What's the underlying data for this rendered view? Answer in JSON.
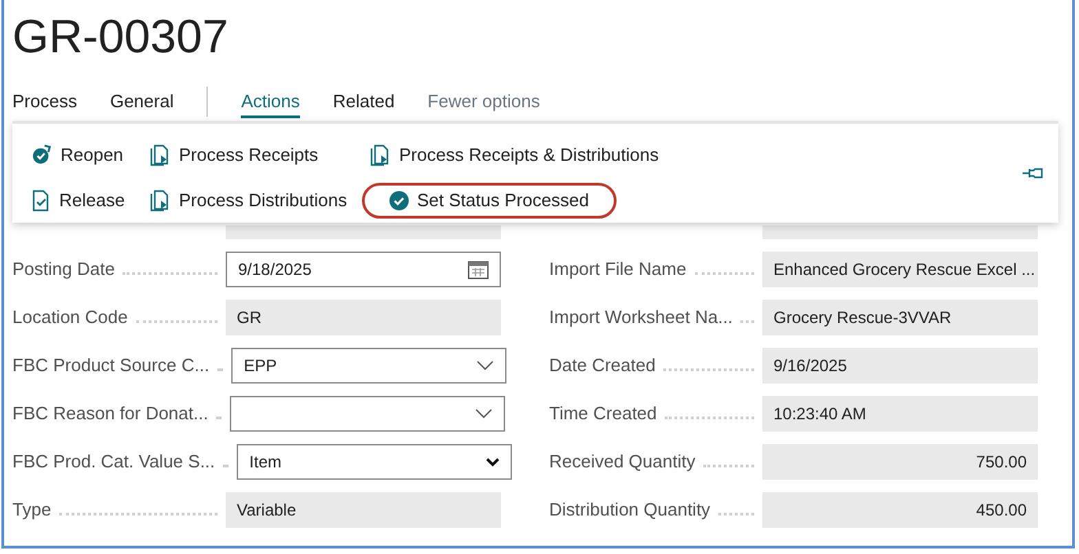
{
  "title": "GR-00307",
  "tabs": [
    {
      "label": "Process",
      "selected": false
    },
    {
      "label": "General",
      "selected": false
    },
    {
      "label": "Actions",
      "selected": true
    },
    {
      "label": "Related",
      "selected": false
    }
  ],
  "fewer_options": "Fewer options",
  "actions": [
    {
      "label": "Reopen",
      "kind": "reopen",
      "highlighted": false
    },
    {
      "label": "Process Receipts",
      "kind": "process",
      "highlighted": false
    },
    {
      "label": "Process Receipts & Distributions",
      "kind": "process",
      "highlighted": false
    },
    {
      "label": "Release",
      "kind": "release",
      "highlighted": false
    },
    {
      "label": "Process Distributions",
      "kind": "process",
      "highlighted": false
    },
    {
      "label": "Set Status Processed",
      "kind": "status",
      "highlighted": true
    }
  ],
  "left_fields": [
    {
      "label": "Posting Date",
      "value": "9/18/2025",
      "kind": "date"
    },
    {
      "label": "Location Code",
      "value": "GR",
      "kind": "readonly"
    },
    {
      "label": "FBC Product Source C...",
      "value": "EPP",
      "kind": "dropdown"
    },
    {
      "label": "FBC Reason for Donat...",
      "kind": "dropdown"
    },
    {
      "label": "FBC Prod. Cat. Value S...",
      "value": "Item",
      "kind": "select"
    },
    {
      "label": "Type",
      "value": "Variable",
      "kind": "readonly"
    }
  ],
  "right_fields": [
    {
      "label": "Import File Name",
      "value": "Enhanced Grocery Rescue Excel ...",
      "kind": "readonly"
    },
    {
      "label": "Import Worksheet Na...",
      "value": "Grocery Rescue-3VVAR",
      "kind": "readonly"
    },
    {
      "label": "Date Created",
      "value": "9/16/2025",
      "kind": "readonly"
    },
    {
      "label": "Time Created",
      "value": "10:23:40 AM",
      "kind": "readonly"
    },
    {
      "label": "Received Quantity",
      "value": "750.00",
      "kind": "number"
    },
    {
      "label": "Distribution Quantity",
      "value": "450.00",
      "kind": "number"
    }
  ]
}
